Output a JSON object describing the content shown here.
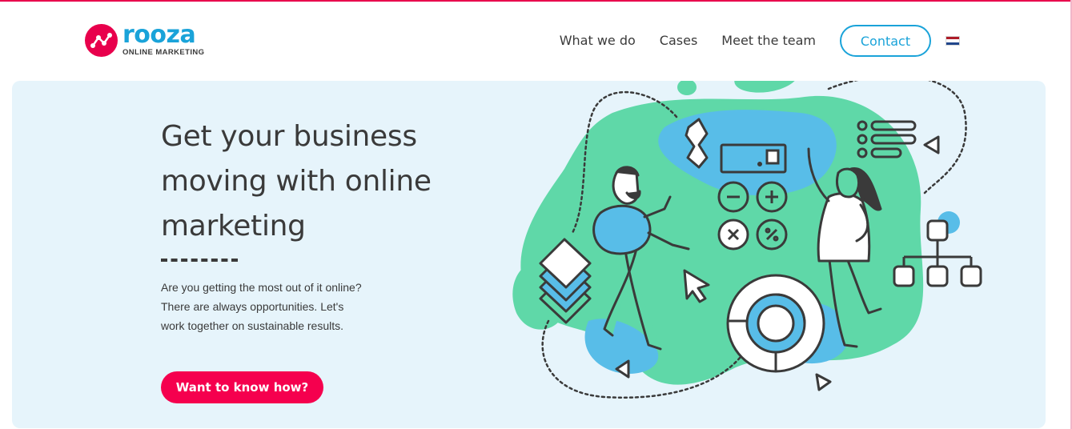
{
  "header": {
    "logo": {
      "word": "rooza",
      "tagline": "ONLINE MARKETING"
    },
    "nav": [
      {
        "label": "What we do"
      },
      {
        "label": "Cases"
      },
      {
        "label": "Meet the team"
      }
    ],
    "contact_label": "Contact",
    "language_flag": "netherlands-flag-icon"
  },
  "hero": {
    "title": "Get your business moving with online marketing",
    "description": "Are you getting the most out of it online? There are always opportunities. Let's work together on sustainable results.",
    "cta_label": "Want to know how?"
  },
  "colors": {
    "brand_pink": "#f5004e",
    "brand_blue": "#1aa3d9",
    "hero_bg": "#e6f4fb",
    "illustration_green": "#5fd8a8",
    "illustration_blue": "#58bde8",
    "flag": [
      "#ae1c28",
      "#ffffff",
      "#21468b"
    ]
  }
}
